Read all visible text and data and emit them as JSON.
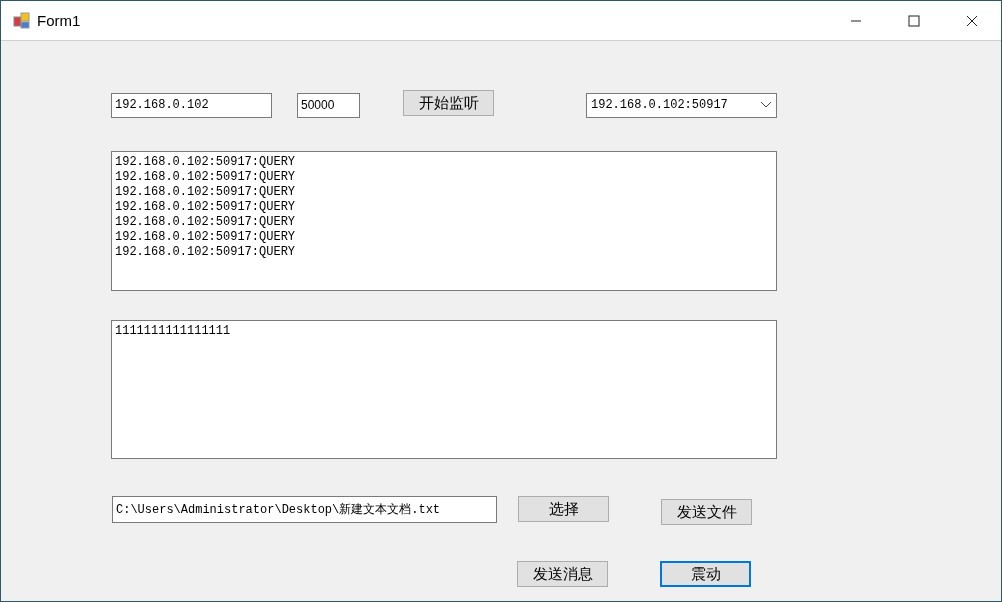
{
  "window": {
    "title": "Form1"
  },
  "ip_field": {
    "value": "192.168.0.102"
  },
  "port_field": {
    "value": "50000"
  },
  "listen_button": {
    "label": "开始监听",
    "focused": false
  },
  "client_combo": {
    "value": "192.168.0.102:50917"
  },
  "log_lines": [
    "192.168.0.102:50917:QUERY",
    "192.168.0.102:50917:QUERY",
    "192.168.0.102:50917:QUERY",
    "192.168.0.102:50917:QUERY",
    "192.168.0.102:50917:QUERY",
    "192.168.0.102:50917:QUERY",
    "192.168.0.102:50917:QUERY"
  ],
  "message_box": {
    "value": "1111111111111111"
  },
  "file_path_field": {
    "value": "C:\\Users\\Administrator\\Desktop\\新建文本文档.txt"
  },
  "choose_button": {
    "label": "选择",
    "focused": false
  },
  "send_file_button": {
    "label": "发送文件",
    "focused": false
  },
  "send_message_button": {
    "label": "发送消息",
    "focused": false
  },
  "vibrate_button": {
    "label": "震动",
    "focused": true
  }
}
